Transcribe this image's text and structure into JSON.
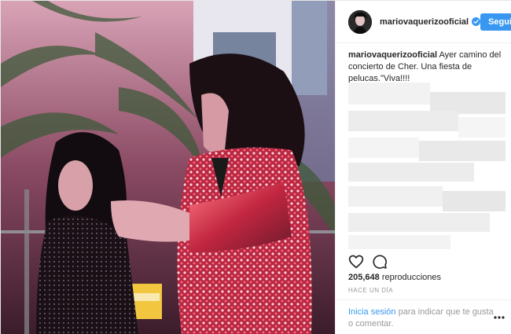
{
  "post": {
    "username": "mariovaquerizooficial",
    "verified": true,
    "follow_label": "Seguir",
    "caption_user": "mariovaquerizooficial",
    "caption_text": "Ayer camino del concierto de Cher. Una fiesta de pelucas.\"Viva!!!!",
    "views_count": "205,648",
    "views_label": "reproducciones",
    "timestamp": "HACE UN DÍA",
    "login_link": "Inicia sesión",
    "login_text": "para indicar que te gusta o comentar.",
    "icons": {
      "verified": "verified-badge-icon",
      "like": "heart-icon",
      "comment": "comment-bubble-icon",
      "more": "more-options-icon"
    },
    "colors": {
      "accent": "#3897f0",
      "text": "#262626",
      "muted": "#999999",
      "border": "#efefef"
    }
  }
}
